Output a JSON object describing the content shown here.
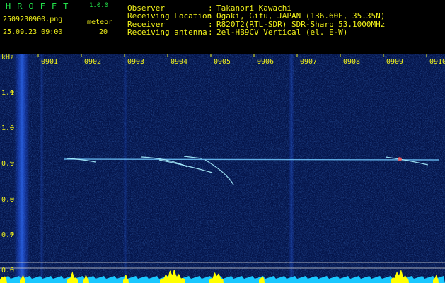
{
  "header": {
    "app_title": "HROFFT",
    "version": "1.0.0",
    "file_name": "2509230900.png",
    "date_time": "25.09.23 09:00",
    "meteor_label": "meteor",
    "meteor_count": "20"
  },
  "station_info": [
    {
      "label": "Observer",
      "value": "Takanori Kawachi"
    },
    {
      "label": "Receiving Location",
      "value": "Ogaki, Gifu, JAPAN (136.60E, 35.35N)"
    },
    {
      "label": "Receiver",
      "value": "R820T2(RTL-SDR) SDR-Sharp 53.1000MHz"
    },
    {
      "label": "Receiving antenna",
      "value": "2el-HB9CV Vertical (el. E-W)"
    }
  ],
  "axes": {
    "y_unit": "kHz",
    "y_ticks": [
      "1.1",
      "1.0",
      "0.9",
      "0.8",
      "0.7",
      "0.6"
    ],
    "x_ticks": [
      "0901",
      "0902",
      "0903",
      "0904",
      "0905",
      "0906",
      "0907",
      "0908",
      "0909",
      "0910"
    ]
  },
  "colors": {
    "background": "#000000",
    "spectrogram": "#04144a",
    "text": "#f2f21a",
    "title": "#22e04a",
    "carrier": "#70c8ff",
    "noise_floor": "#19c8ff",
    "meteor_bursts": "#ffff00"
  }
}
